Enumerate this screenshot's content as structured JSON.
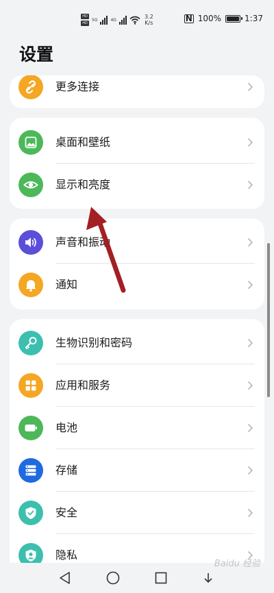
{
  "status_bar": {
    "hd1": "HD",
    "hd2": "HD",
    "net1": "5G",
    "net2": "4G",
    "speed_value": "3.2",
    "speed_unit": "K/s",
    "nfc": "N",
    "battery": "100%",
    "time": "1:37"
  },
  "page": {
    "title": "设置"
  },
  "groups": [
    {
      "items": [
        {
          "label": "更多连接",
          "icon": "link-icon",
          "color": "#f5a623"
        }
      ]
    },
    {
      "items": [
        {
          "label": "桌面和壁纸",
          "icon": "wallpaper-icon",
          "color": "#4cb85a"
        },
        {
          "label": "显示和亮度",
          "icon": "eye-icon",
          "color": "#4cb85a"
        }
      ]
    },
    {
      "items": [
        {
          "label": "声音和振动",
          "icon": "speaker-icon",
          "color": "#5b4fd9"
        },
        {
          "label": "通知",
          "icon": "bell-icon",
          "color": "#f5a623"
        }
      ]
    },
    {
      "items": [
        {
          "label": "生物识别和密码",
          "icon": "key-icon",
          "color": "#3cbfae"
        },
        {
          "label": "应用和服务",
          "icon": "apps-icon",
          "color": "#f5a623"
        },
        {
          "label": "电池",
          "icon": "battery-icon",
          "color": "#4cb85a"
        },
        {
          "label": "存储",
          "icon": "storage-icon",
          "color": "#1e6ae0"
        },
        {
          "label": "安全",
          "icon": "shield-icon",
          "color": "#3cbfae"
        },
        {
          "label": "隐私",
          "icon": "privacy-icon",
          "color": "#3cbfae"
        }
      ]
    }
  ],
  "watermark": "Baidu 经验",
  "colors": {
    "background": "#f1f3f5",
    "card": "#ffffff",
    "annotation_arrow": "#a31f24"
  }
}
